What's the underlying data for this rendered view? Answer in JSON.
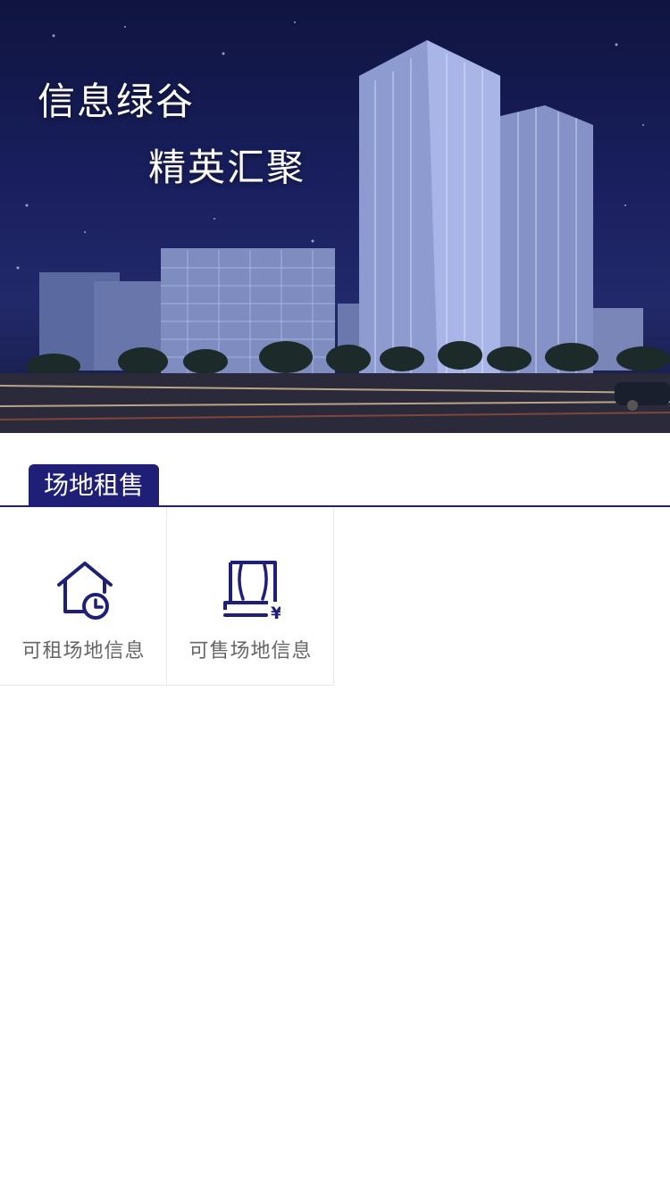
{
  "banner": {
    "slogan_line1": "信息绿谷",
    "slogan_line2": "精英汇聚",
    "colors": {
      "night_sky": "#1a2060"
    }
  },
  "section": {
    "title": "场地租售",
    "accent_color": "#1f1f78"
  },
  "services": [
    {
      "label": "可租场地信息",
      "icon": "house-clock-icon"
    },
    {
      "label": "可售场地信息",
      "icon": "building-yen-icon"
    }
  ]
}
